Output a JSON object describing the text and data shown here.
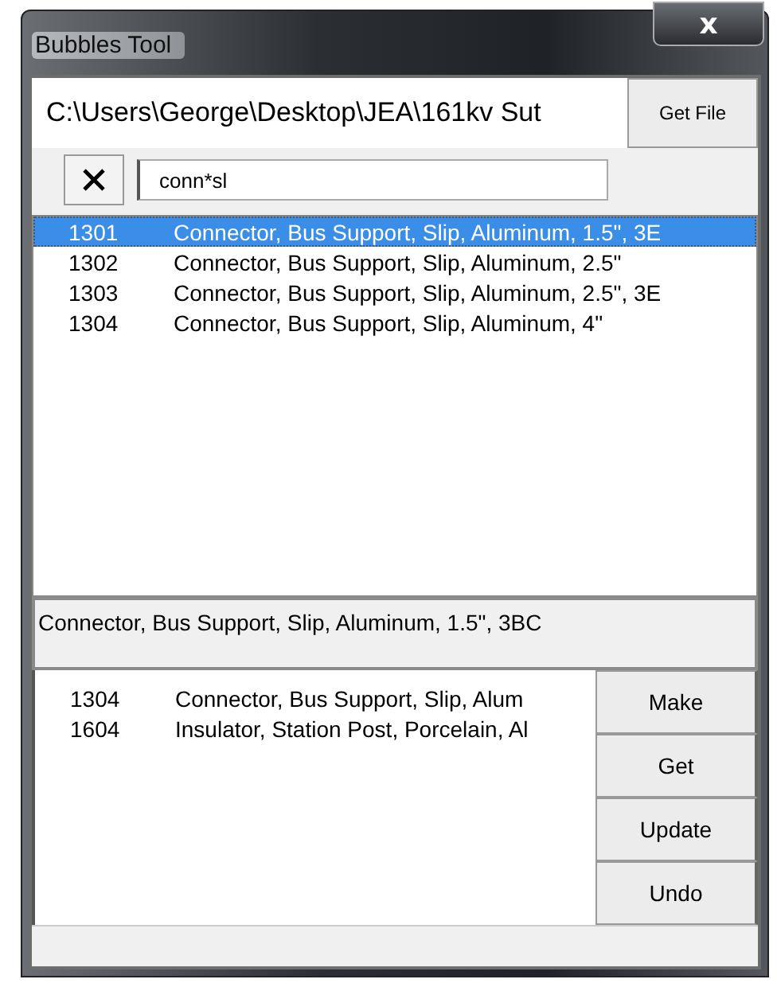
{
  "window": {
    "title": "Bubbles Tool",
    "close": "x"
  },
  "file_path": {
    "value": "C:\\Users\\George\\Desktop\\JEA\\161kv Sut"
  },
  "get_file_button": "Get File",
  "search": {
    "value": "conn*sl"
  },
  "results": [
    {
      "number": "1301",
      "description": "Connector, Bus Support, Slip, Aluminum, 1.5\", 3E",
      "selected": true
    },
    {
      "number": "1302",
      "description": "Connector, Bus Support, Slip, Aluminum, 2.5\"",
      "selected": false
    },
    {
      "number": "1303",
      "description": "Connector, Bus Support, Slip, Aluminum, 2.5\", 3E",
      "selected": false
    },
    {
      "number": "1304",
      "description": "Connector, Bus Support, Slip, Aluminum, 4\"",
      "selected": false
    }
  ],
  "description": "Connector, Bus Support, Slip, Aluminum, 1.5\", 3BC",
  "picked": [
    {
      "number": "1304",
      "description": "Connector, Bus Support, Slip, Alum"
    },
    {
      "number": "1604",
      "description": "Insulator, Station Post, Porcelain, Al"
    }
  ],
  "buttons": [
    "Make",
    "Get",
    "Update",
    "Undo"
  ]
}
